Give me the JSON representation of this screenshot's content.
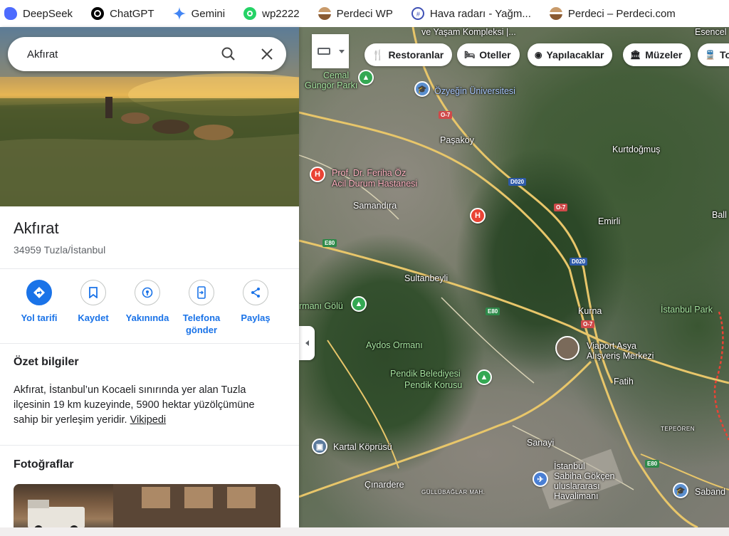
{
  "bookmarks": [
    {
      "label": "DeepSeek",
      "icon": "deepseek-icon",
      "color": "#4d6bfe"
    },
    {
      "label": "ChatGPT",
      "icon": "chatgpt-icon",
      "color": "#000000"
    },
    {
      "label": "Gemini",
      "icon": "gemini-icon",
      "color": "#4285f4"
    },
    {
      "label": "wp2222",
      "icon": "whatsapp-icon",
      "color": "#25d366"
    },
    {
      "label": "Perdeci WP",
      "icon": "perdeci-icon",
      "color": "#a0744a"
    },
    {
      "label": "Hava radarı - Yağm...",
      "icon": "radar-icon",
      "color": "#3f51b5"
    },
    {
      "label": "Perdeci – Perdeci.com",
      "icon": "perdeci-icon",
      "color": "#a0744a"
    }
  ],
  "search": {
    "value": "Akfırat",
    "search_icon": "search-icon",
    "clear_icon": "close-icon"
  },
  "place": {
    "title": "Akfırat",
    "address": "34959 Tuzla/İstanbul"
  },
  "actions": [
    {
      "label": "Yol tarifi",
      "icon": "directions-icon"
    },
    {
      "label": "Kaydet",
      "icon": "bookmark-icon"
    },
    {
      "label": "Yakınında",
      "icon": "nearby-icon"
    },
    {
      "label": "Telefona gönder",
      "icon": "send-to-phone-icon"
    },
    {
      "label": "Paylaş",
      "icon": "share-icon"
    }
  ],
  "summary": {
    "title": "Özet bilgiler",
    "text": "Akfırat, İstanbul’un Kocaeli sınırında yer alan Tuzla ilçesinin 19 km kuzeyinde, 5900 hektar yüzölçümüne sahip bir yerleşim yeridir.",
    "link": "Vikipedi"
  },
  "photos": {
    "title": "Fotoğraflar"
  },
  "chips": [
    {
      "label": "Restoranlar",
      "icon": "restaurant-icon"
    },
    {
      "label": "Oteller",
      "icon": "hotel-icon"
    },
    {
      "label": "Yapılacaklar",
      "icon": "camera-icon"
    },
    {
      "label": "Müzeler",
      "icon": "museum-icon"
    },
    {
      "label": "To",
      "icon": "transit-icon"
    }
  ],
  "map_labels": {
    "yasam": "ve Yaşam Kompleksi |...",
    "esencel": "Esencel",
    "cemal": "Cemal",
    "gungor": "Güngör Parkı",
    "ozyegin": "Özyeğin Üniversitesi",
    "pasakoy": "Paşaköy",
    "kurtdogmus": "Kurtdoğmuş",
    "ferihaoz": "Prof. Dr. Feriha Öz",
    "acil": "Acil Durum Hastanesi",
    "samandira": "Samandıra",
    "emirli": "Emirli",
    "ball": "Ball",
    "sultanbeyli": "Sultanbeyli",
    "kurna": "Kurna",
    "ormani_golu": "rmanı Gölü",
    "istanbul_park": "İstanbul Park",
    "aydos": "Aydos Ormanı",
    "viaport1": "Viaport Asya",
    "viaport2": "Alışveriş Merkezi",
    "pendik1": "Pendik Belediyesi",
    "pendik2": "Pendik Korusu",
    "fatih": "Fatih",
    "tepeoren": "TEPEÖREN",
    "sanayi": "Sanayi",
    "kartal": "Kartal Köprüsü",
    "sabiha1": "İstanbul",
    "sabiha2": "Sabiha Gökçen",
    "sabiha3": "uluslararası",
    "sabiha4": "Havalimanı",
    "cinardere": "Çınardere",
    "gullubaglar": "GÜLLÜBAĞLAR MAH.",
    "sabanci": "Saband"
  },
  "road_shields": {
    "o7_a": "O-7",
    "d020_a": "D020",
    "o7_b": "O-7",
    "e80_a": "E80",
    "d020_b": "D020",
    "e80_b": "E80",
    "o7_c": "O-7",
    "e80_c": "E80"
  },
  "colors": {
    "accent": "#1a73e8",
    "hospital": "#ea4335",
    "park": "#34a853"
  }
}
